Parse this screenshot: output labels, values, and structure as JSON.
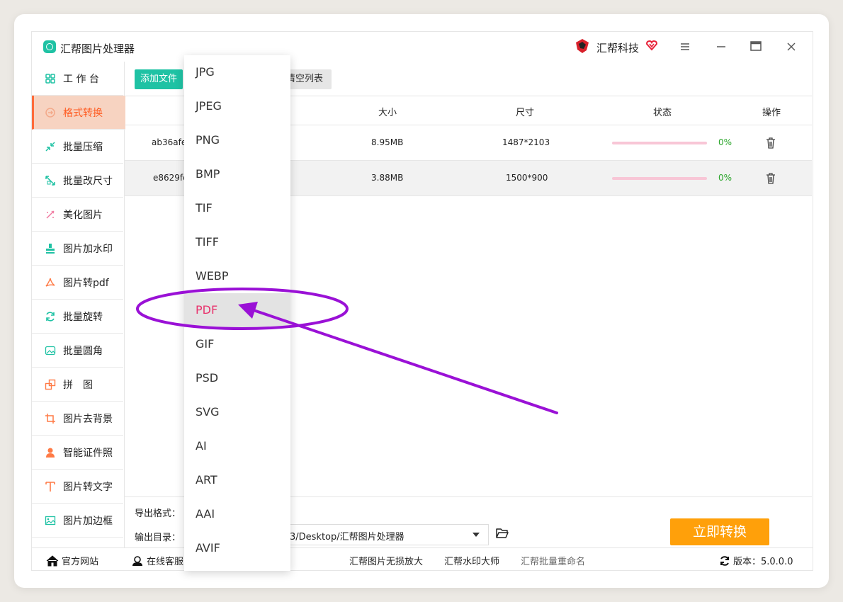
{
  "app": {
    "title": "汇帮图片处理器",
    "brand": "汇帮科技"
  },
  "sidebar": {
    "items": [
      {
        "label": "工 作 台",
        "icon": "grid-icon"
      },
      {
        "label": "格式转换",
        "icon": "format-convert-icon",
        "active": true
      },
      {
        "label": "批量压缩",
        "icon": "compress-icon"
      },
      {
        "label": "批量改尺寸",
        "icon": "resize-icon"
      },
      {
        "label": "美化图片",
        "icon": "beautify-icon"
      },
      {
        "label": "图片加水印",
        "icon": "watermark-icon"
      },
      {
        "label": "图片转pdf",
        "icon": "pdf-icon"
      },
      {
        "label": "批量旋转",
        "icon": "rotate-icon"
      },
      {
        "label": "批量圆角",
        "icon": "rounded-corner-icon"
      },
      {
        "label": "拼　图",
        "icon": "puzzle-icon"
      },
      {
        "label": "图片去背景",
        "icon": "crop-icon"
      },
      {
        "label": "智能证件照",
        "icon": "person-icon"
      },
      {
        "label": "图片转文字",
        "icon": "text-icon"
      },
      {
        "label": "图片加边框",
        "icon": "image-frame-icon"
      }
    ]
  },
  "toolbar": {
    "add_label": "添加文件",
    "clear_label": "清空列表"
  },
  "table": {
    "headers": {
      "size": "大小",
      "dimensions": "尺寸",
      "status": "状态",
      "actions": "操作"
    },
    "rows": [
      {
        "name": "ab36afe",
        "size": "8.95MB",
        "dimensions": "1487*2103",
        "progress": 0,
        "progress_label": "0%"
      },
      {
        "name": "e8629fd",
        "size": "3.88MB",
        "dimensions": "1500*900",
        "progress": 0,
        "progress_label": "0%"
      }
    ]
  },
  "output": {
    "format_label": "导出格式：",
    "dir_label": "输出目录：",
    "dir_value": "3/Desktop/汇帮图片处理器",
    "convert_label": "立即转换"
  },
  "footer": {
    "official_site": "官方网站",
    "online_service": "在线客服",
    "link1": "汇帮图片无损放大",
    "link2": "汇帮水印大师",
    "link3": "汇帮批量重命名",
    "version": "版本：5.0.0.0"
  },
  "dropdown": {
    "options": [
      "JPG",
      "JPEG",
      "PNG",
      "BMP",
      "TIF",
      "TIFF",
      "WEBP",
      "PDF",
      "GIF",
      "PSD",
      "SVG",
      "AI",
      "ART",
      "AAI",
      "AVIF"
    ],
    "highlighted": "PDF"
  },
  "colors": {
    "accent_teal": "#1fc2a4",
    "accent_orange": "#ff6b3a",
    "convert_orange": "#ffa00a",
    "highlight_pink": "#e8336d",
    "annotation_purple": "#9a11d6"
  }
}
